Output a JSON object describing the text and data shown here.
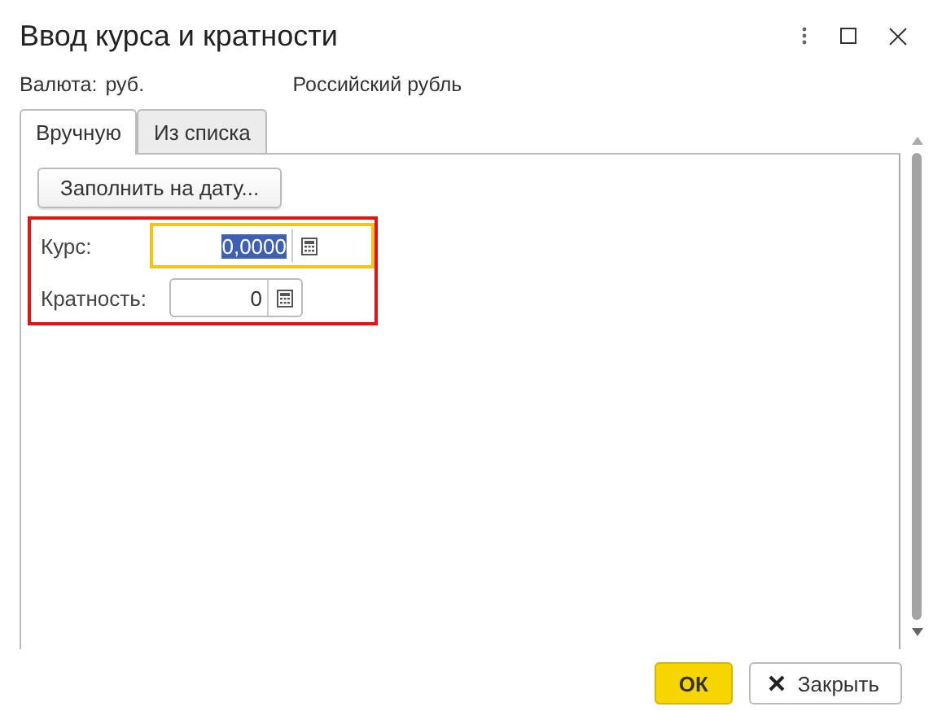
{
  "window": {
    "title": "Ввод курса и кратности"
  },
  "currency": {
    "label": "Валюта:",
    "code": "руб.",
    "name": "Российский рубль"
  },
  "tabs": [
    {
      "label": "Вручную",
      "selected": true
    },
    {
      "label": "Из списка",
      "selected": false
    }
  ],
  "fill_button": "Заполнить на дату...",
  "fields_highlighted": true,
  "fields": [
    {
      "label": "Курс:",
      "value": "0,0000",
      "focused": true,
      "text_selected": true
    },
    {
      "label": "Кратность:",
      "value": "0",
      "focused": false,
      "text_selected": false
    }
  ],
  "buttons": [
    {
      "label": "ОК",
      "kind": "primary"
    },
    {
      "label": "Закрыть",
      "kind": "close"
    }
  ]
}
